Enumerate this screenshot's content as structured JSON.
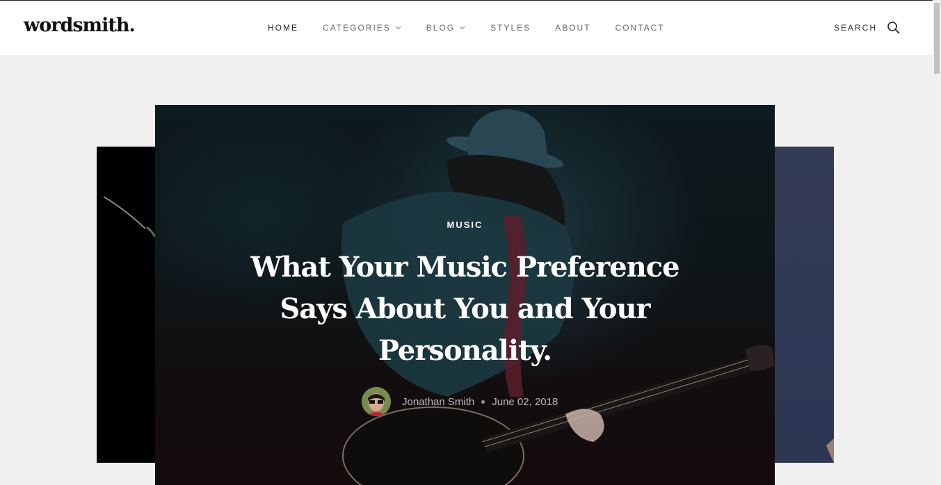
{
  "header": {
    "logo": "wordsmith.",
    "nav": [
      {
        "label": "HOME",
        "has_dropdown": false,
        "active": true
      },
      {
        "label": "CATEGORIES",
        "has_dropdown": true,
        "active": false
      },
      {
        "label": "BLOG",
        "has_dropdown": true,
        "active": false
      },
      {
        "label": "STYLES",
        "has_dropdown": false,
        "active": false
      },
      {
        "label": "ABOUT",
        "has_dropdown": false,
        "active": false
      },
      {
        "label": "CONTACT",
        "has_dropdown": false,
        "active": false
      }
    ],
    "search_label": "SEARCH"
  },
  "slider": {
    "current": {
      "category": "MUSIC",
      "title": "What Your Music Preference Says About You and Your Personality.",
      "author": "Jonathan Smith",
      "date": "June 02, 2018"
    }
  },
  "colors": {
    "header_bg": "#ffffff",
    "page_bg": "#f0f0f0",
    "text_dark": "#111111",
    "nav_text": "#666666"
  },
  "icons": [
    "chevron-down-icon",
    "search-icon"
  ]
}
